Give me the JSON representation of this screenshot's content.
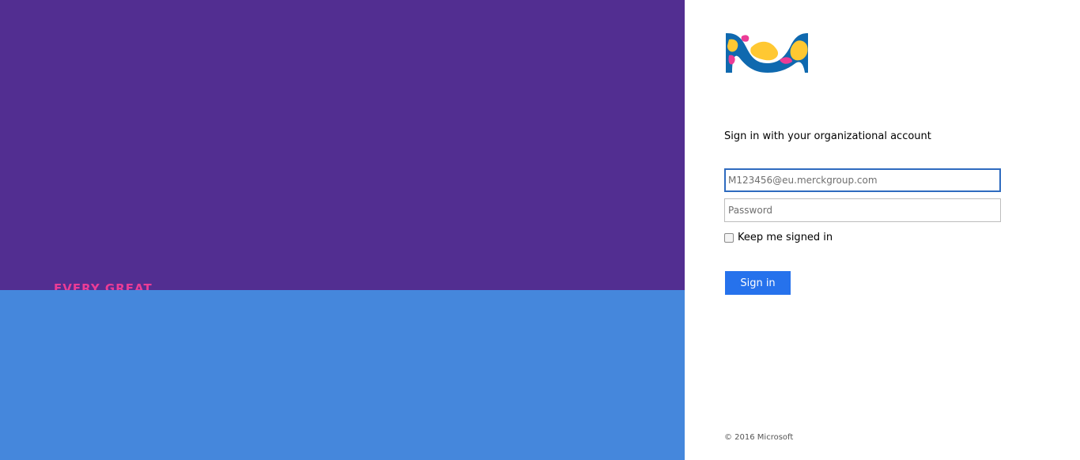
{
  "background": {
    "colors": {
      "top": "#522e91",
      "bottom": "#4587dc",
      "tagline": "#eb3c96"
    },
    "tagline_peek": "EVERY GREAT"
  },
  "brand": {
    "logo_icon": "merck-m-logo",
    "colors": {
      "blue": "#0f69af",
      "yellow": "#ffc832",
      "pink": "#eb3c96"
    }
  },
  "login": {
    "heading": "Sign in with your organizational account",
    "username": {
      "value": "",
      "placeholder": "M123456@eu.merckgroup.com"
    },
    "password": {
      "value": "",
      "placeholder": "Password"
    },
    "keep_signed_in": {
      "label": "Keep me signed in",
      "checked": false
    },
    "sign_in_label": "Sign in",
    "accent_color": "#2672ec"
  },
  "footer": {
    "copyright": "© 2016 Microsoft"
  }
}
